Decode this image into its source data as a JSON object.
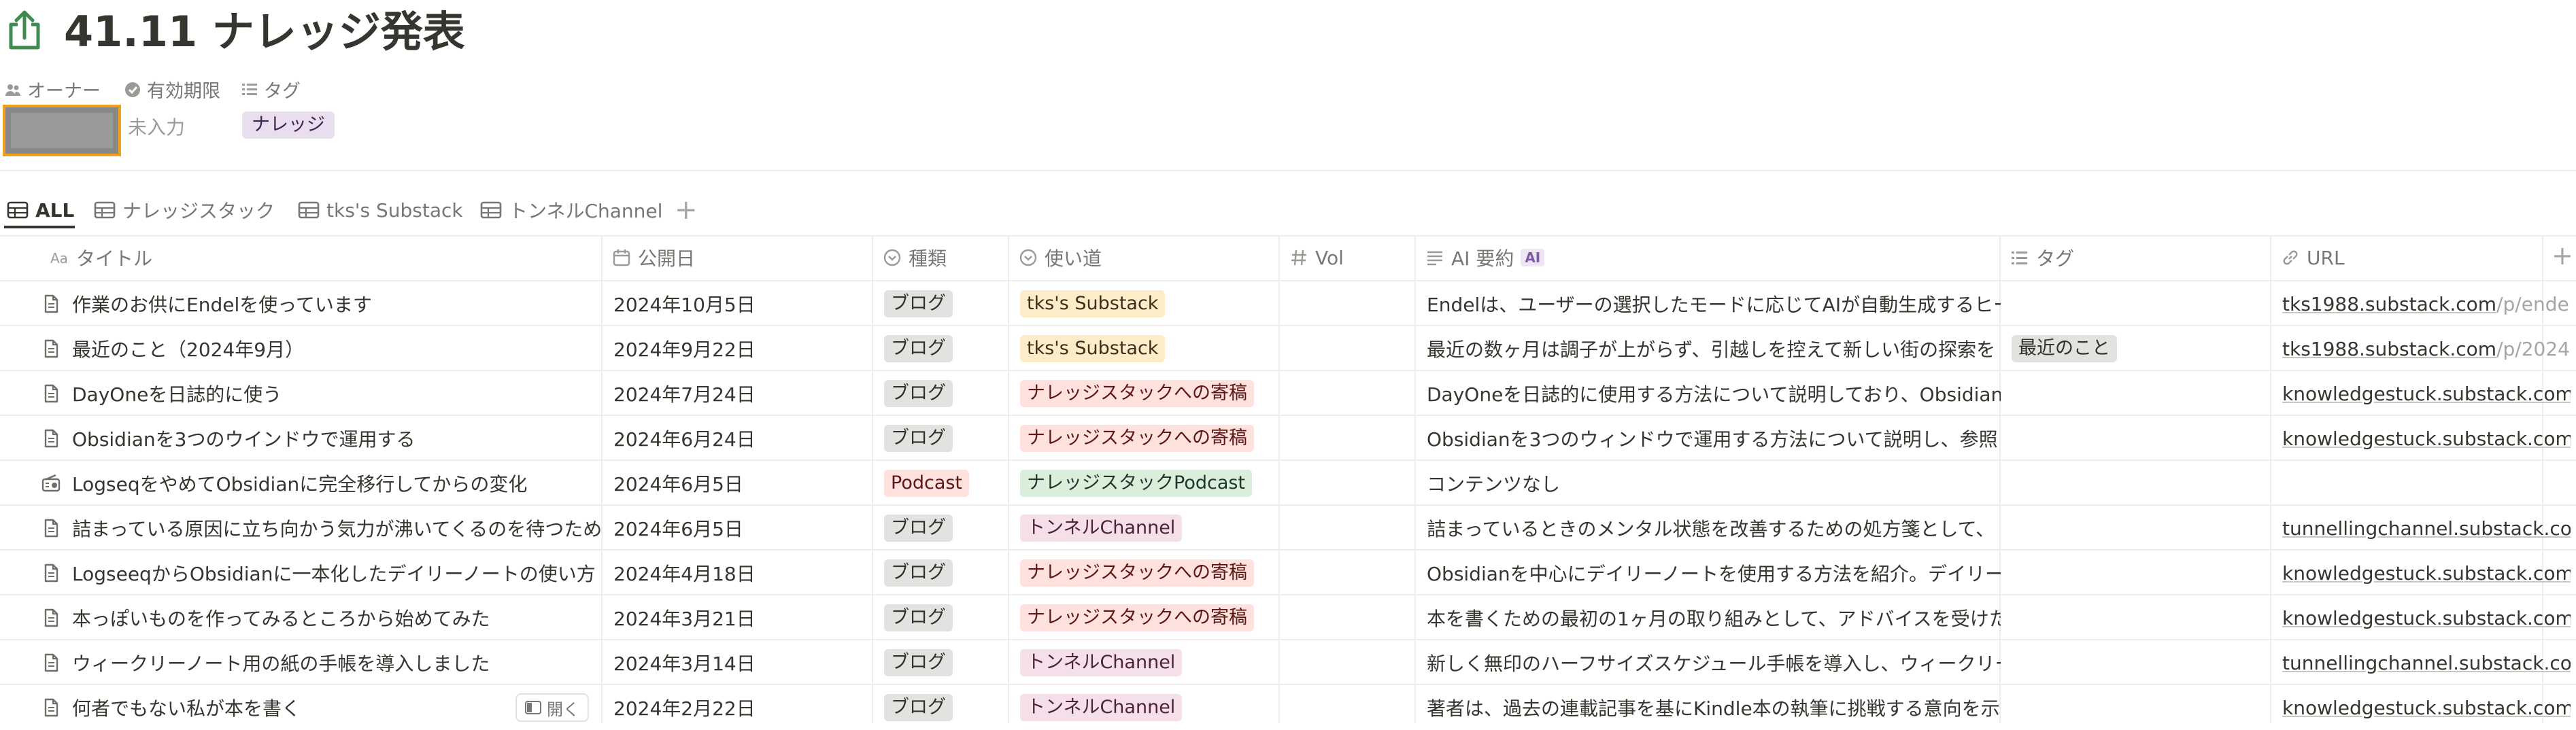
{
  "page": {
    "title": "41.11 ナレッジ発表",
    "icon": "share-upload-icon"
  },
  "properties": {
    "owner_label": "オーナー",
    "expiry_label": "有効期限",
    "tag_label": "タグ",
    "expiry_value": "未入力",
    "tag_value": "ナレッジ"
  },
  "views": {
    "tabs": [
      {
        "label": "ALL",
        "active": true
      },
      {
        "label": "ナレッジスタック",
        "active": false
      },
      {
        "label": "tks's Substack",
        "active": false
      },
      {
        "label": "トンネルChannel",
        "active": false
      }
    ],
    "add_label": "+"
  },
  "table": {
    "columns": [
      {
        "label": "タイトル",
        "icon": "text-aa-icon"
      },
      {
        "label": "公開日",
        "icon": "calendar-icon"
      },
      {
        "label": "種類",
        "icon": "select-icon"
      },
      {
        "label": "使い道",
        "icon": "select-icon"
      },
      {
        "label": "Vol",
        "icon": "number-hash-icon"
      },
      {
        "label": "AI 要約",
        "icon": "text-lines-icon",
        "badge": "AI"
      },
      {
        "label": "タグ",
        "icon": "list-icon"
      },
      {
        "label": "URL",
        "icon": "link-icon"
      }
    ],
    "add_column_label": "+",
    "open_label": "開く",
    "rows": [
      {
        "title": "作業のお供にEndelを使っています",
        "date": "2024年10月5日",
        "type": "ブログ",
        "usage": "tks's Substack",
        "usage_color": "yellow",
        "vol": "",
        "summary": "Endelは、ユーザーの選択したモードに応じてAIが自動生成するヒー",
        "tag": "",
        "url_main": "tks1988.substack.com",
        "url_dim": "/p/endel"
      },
      {
        "title": "最近のこと（2024年9月）",
        "date": "2024年9月22日",
        "type": "ブログ",
        "usage": "tks's Substack",
        "usage_color": "yellow",
        "vol": "",
        "summary": "最近の数ヶ月は調子が上がらず、引越しを控えて新しい街の探索を",
        "tag": "最近のこと",
        "url_main": "tks1988.substack.com",
        "url_dim": "/p/2024"
      },
      {
        "title": "DayOneを日誌的に使う",
        "date": "2024年7月24日",
        "type": "ブログ",
        "usage": "ナレッジスタックへの寄稿",
        "usage_color": "red",
        "vol": "",
        "summary": "DayOneを日誌的に使用する方法について説明しており、Obsidian",
        "tag": "",
        "url_main": "knowledgestuck.substack.com",
        "url_dim": ""
      },
      {
        "title": "Obsidianを3つのウインドウで運用する",
        "date": "2024年6月24日",
        "type": "ブログ",
        "usage": "ナレッジスタックへの寄稿",
        "usage_color": "red",
        "vol": "",
        "summary": "Obsidianを3つのウィンドウで運用する方法について説明し、参照",
        "tag": "",
        "url_main": "knowledgestuck.substack.com",
        "url_dim": ""
      },
      {
        "title": "LogseqをやめてObsidianに完全移行してからの変化",
        "date": "2024年6月5日",
        "type": "Podcast",
        "type_color": "red",
        "usage": "ナレッジスタックPodcast",
        "usage_color": "green",
        "vol": "",
        "summary": "コンテンツなし",
        "tag": "",
        "url_main": "",
        "url_dim": ""
      },
      {
        "title": "詰まっている原因に立ち向かう気力が沸いてくるのを待つため",
        "date": "2024年6月5日",
        "type": "ブログ",
        "usage": "トンネルChannel",
        "usage_color": "pink",
        "vol": "",
        "summary": "詰まっているときのメンタル状態を改善するための処方箋として、",
        "tag": "",
        "url_main": "tunnellingchannel.substack.com",
        "url_dim": ""
      },
      {
        "title": "LogseeqからObsidianに一本化したデイリーノートの使い方",
        "date": "2024年4月18日",
        "type": "ブログ",
        "usage": "ナレッジスタックへの寄稿",
        "usage_color": "red",
        "vol": "",
        "summary": "Obsidianを中心にデイリーノートを使用する方法を紹介。デイリー",
        "tag": "",
        "url_main": "knowledgestuck.substack.com",
        "url_dim": ""
      },
      {
        "title": "本っぽいものを作ってみるところから始めてみた",
        "date": "2024年3月21日",
        "type": "ブログ",
        "usage": "ナレッジスタックへの寄稿",
        "usage_color": "red",
        "vol": "",
        "summary": "本を書くための最初の1ヶ月の取り組みとして、アドバイスを受けた",
        "tag": "",
        "url_main": "knowledgestuck.substack.com",
        "url_dim": ""
      },
      {
        "title": "ウィークリーノート用の紙の手帳を導入しました",
        "date": "2024年3月14日",
        "type": "ブログ",
        "usage": "トンネルChannel",
        "usage_color": "pink",
        "vol": "",
        "summary": "新しく無印のハーフサイズスケジュール手帳を導入し、ウィークリー",
        "tag": "",
        "url_main": "tunnellingchannel.substack.com",
        "url_dim": ""
      },
      {
        "title": "何者でもない私が本を書く",
        "date": "2024年2月22日",
        "type": "ブログ",
        "usage": "トンネルChannel",
        "usage_color": "pink",
        "vol": "",
        "summary": "著者は、過去の連載記事を基にKindle本の執筆に挑戦する意向を示",
        "tag": "",
        "url_main": "knowledgestuck.substack.com",
        "url_dim": ""
      }
    ]
  }
}
